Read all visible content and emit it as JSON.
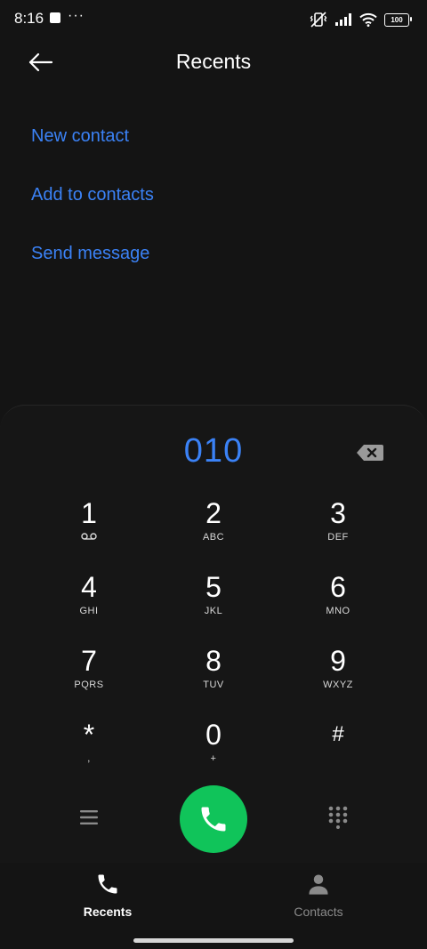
{
  "status": {
    "time": "8:16",
    "dots": "···",
    "battery": "100"
  },
  "header": {
    "title": "Recents"
  },
  "actions": [
    {
      "label": "New contact"
    },
    {
      "label": "Add to contacts"
    },
    {
      "label": "Send message"
    }
  ],
  "dialer": {
    "number": "010",
    "keys": [
      {
        "digit": "1",
        "letters": ""
      },
      {
        "digit": "2",
        "letters": "ABC"
      },
      {
        "digit": "3",
        "letters": "DEF"
      },
      {
        "digit": "4",
        "letters": "GHI"
      },
      {
        "digit": "5",
        "letters": "JKL"
      },
      {
        "digit": "6",
        "letters": "MNO"
      },
      {
        "digit": "7",
        "letters": "PQRS"
      },
      {
        "digit": "8",
        "letters": "TUV"
      },
      {
        "digit": "9",
        "letters": "WXYZ"
      },
      {
        "digit": "*",
        "letters": ","
      },
      {
        "digit": "0",
        "letters": "+"
      },
      {
        "digit": "#",
        "letters": ""
      }
    ]
  },
  "tabs": [
    {
      "label": "Recents",
      "active": true
    },
    {
      "label": "Contacts",
      "active": false
    }
  ],
  "colors": {
    "accent": "#3b82f6",
    "call": "#10c45a",
    "background": "#141414"
  }
}
